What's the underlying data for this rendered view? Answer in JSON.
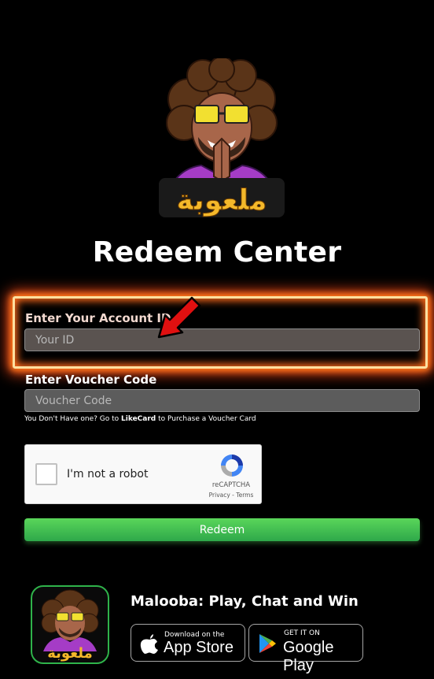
{
  "logo": {
    "arabic_text": "ملعوبة"
  },
  "page": {
    "title": "Redeem Center"
  },
  "form": {
    "account_id_label": "Enter Your Account ID",
    "account_id_placeholder": "Your ID",
    "voucher_label": "Enter Voucher Code",
    "voucher_placeholder": "Voucher Code",
    "hint_prefix": "You Don't Have one? Go to ",
    "hint_link": "LikeCard",
    "hint_suffix": " to Purchase a Voucher Card",
    "redeem_label": "Redeem"
  },
  "recaptcha": {
    "label": "I'm not a robot",
    "brand": "reCAPTCHA",
    "links": "Privacy - Terms"
  },
  "footer": {
    "tagline": "Malooba: Play, Chat and Win",
    "app_store_small": "Download on the",
    "app_store_big": "App Store",
    "google_small": "GET IT ON",
    "google_big": "Google Play"
  },
  "colors": {
    "glow": "#ff6a1a",
    "redeem": "#3fc44f",
    "arrow": "#e01010"
  },
  "icons": [
    "mascot-logo",
    "recaptcha-icon",
    "apple-icon",
    "google-play-icon",
    "red-arrow-icon"
  ]
}
